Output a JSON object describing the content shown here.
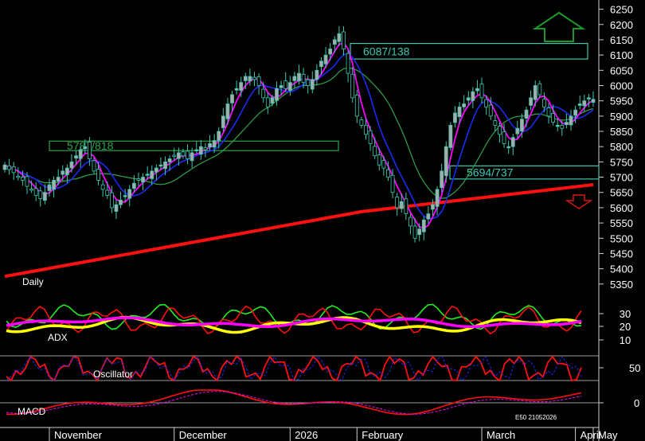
{
  "colors": {
    "background": "#000000",
    "candle_fill": "#aaaaaa",
    "teal": "#3cc8b0",
    "green": "#2fa34a",
    "blue": "#1a2bf5",
    "magenta": "#ff00ff",
    "red": "#ff1010",
    "yellow": "#ffff00",
    "bright_green": "#22ee22",
    "grid": "#cfcfcf",
    "axis_text": "#ffffff",
    "up_arrow": "#1a9a2a",
    "down_arrow": "#d01a10"
  },
  "chart_data": {
    "type": "candlestick",
    "panels": [
      "price",
      "adx",
      "oscillator",
      "macd"
    ],
    "price": {
      "ylim": [
        5300,
        6275
      ],
      "yticks": [
        5350,
        5400,
        5450,
        5500,
        5550,
        5600,
        5650,
        5700,
        5750,
        5800,
        5850,
        5900,
        5950,
        6000,
        6050,
        6100,
        6150,
        6200,
        6250
      ],
      "ytick_labels": [
        "5350",
        "5400",
        "5450",
        "5500",
        "5550",
        "5600",
        "5650",
        "5700",
        "5750",
        "5800",
        "5850",
        "5900",
        "5950",
        "6000",
        "6050",
        "6100",
        "6150",
        "6200",
        "6250"
      ],
      "closes": [
        5740,
        5725,
        5715,
        5700,
        5690,
        5670,
        5660,
        5640,
        5630,
        5650,
        5675,
        5690,
        5700,
        5720,
        5730,
        5750,
        5770,
        5790,
        5800,
        5760,
        5720,
        5690,
        5660,
        5640,
        5600,
        5610,
        5625,
        5640,
        5660,
        5680,
        5690,
        5700,
        5710,
        5720,
        5730,
        5740,
        5750,
        5760,
        5770,
        5780,
        5770,
        5760,
        5780,
        5790,
        5800,
        5790,
        5810,
        5820,
        5850,
        5900,
        5940,
        5970,
        5990,
        6010,
        6030,
        6030,
        6020,
        6000,
        5960,
        5930,
        5960,
        5990,
        6000,
        5990,
        6010,
        6030,
        6040,
        6010,
        6000,
        6020,
        6050,
        6080,
        6100,
        6120,
        6150,
        6170,
        6120,
        6040,
        5960,
        5900,
        5870,
        5840,
        5810,
        5770,
        5740,
        5730,
        5700,
        5650,
        5600,
        5620,
        5580,
        5540,
        5500,
        5530,
        5560,
        5580,
        5610,
        5660,
        5720,
        5800,
        5870,
        5910,
        5930,
        5940,
        5960,
        5980,
        5990,
        5960,
        5930,
        5900,
        5870,
        5840,
        5810,
        5800,
        5830,
        5860,
        5890,
        5920,
        5960,
        6000,
        5970,
        5930,
        5900,
        5880,
        5870,
        5860,
        5880,
        5900,
        5920,
        5940,
        5950,
        5960,
        5955
      ],
      "levels": [
        {
          "label": "6087/138",
          "low": 6087,
          "high": 6138
        },
        {
          "label": "5787/818",
          "low": 5787,
          "high": 5818
        },
        {
          "label": "5694/737",
          "low": 5694,
          "high": 5737
        }
      ],
      "annotation": "Daily"
    },
    "adx": {
      "label": "ADX",
      "yticks": [
        10,
        20,
        30
      ],
      "ytick_labels": [
        "10",
        "20",
        "30"
      ]
    },
    "oscillator": {
      "label": "Oscillator",
      "yticks": [
        50
      ],
      "ytick_labels": [
        "50"
      ]
    },
    "macd": {
      "label": "MACD",
      "yticks": [
        0
      ],
      "ytick_labels": [
        "0"
      ],
      "footer": "E50 21052026"
    },
    "x_axis": {
      "labels": [
        "November",
        "December",
        "2026",
        "February",
        "March",
        "April",
        "May"
      ],
      "positions": [
        10,
        38,
        64,
        79,
        107,
        128,
        151
      ]
    }
  }
}
